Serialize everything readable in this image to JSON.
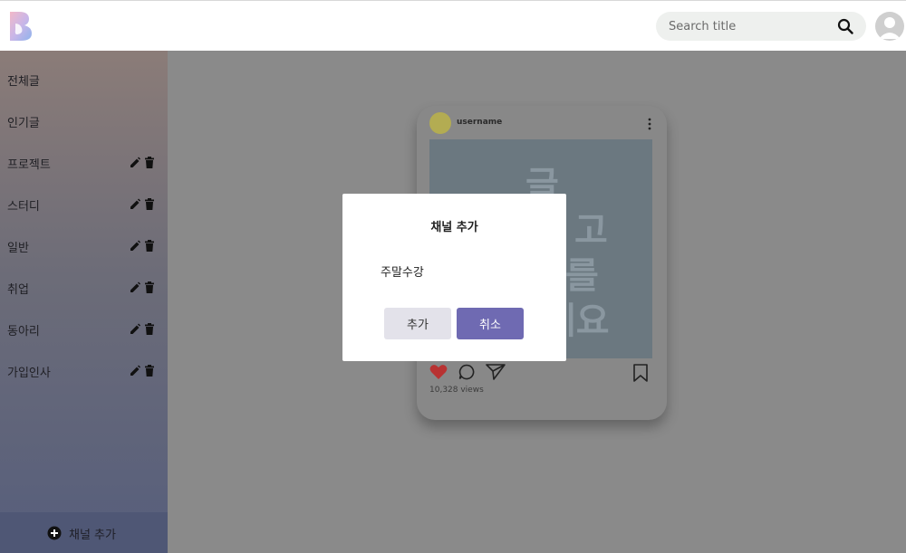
{
  "header": {
    "logo": "B-logo",
    "search": {
      "placeholder": "Search title",
      "icon": "search-icon"
    },
    "avatar": "user-avatar"
  },
  "sidebar": {
    "items": [
      {
        "label": "전체글",
        "editable": false
      },
      {
        "label": "인기글",
        "editable": false
      },
      {
        "label": "프로젝트",
        "editable": true
      },
      {
        "label": "스터디",
        "editable": true
      },
      {
        "label": "일반",
        "editable": true
      },
      {
        "label": "취업",
        "editable": true
      },
      {
        "label": "동아리",
        "editable": true
      },
      {
        "label": "가입인사",
        "editable": true
      }
    ],
    "add_channel_label": "채널 추가"
  },
  "card": {
    "username": "username",
    "image_lines": [
      "글",
      "고",
      "를",
      "세요"
    ],
    "views": "10,328 views",
    "liked": true
  },
  "modal": {
    "title": "채널 추가",
    "input_value": "주말수강",
    "add_label": "추가",
    "cancel_label": "취소"
  },
  "colors": {
    "accent": "#6f6ab2",
    "like": "#c0392b",
    "overlay": "#8a8a8a"
  }
}
